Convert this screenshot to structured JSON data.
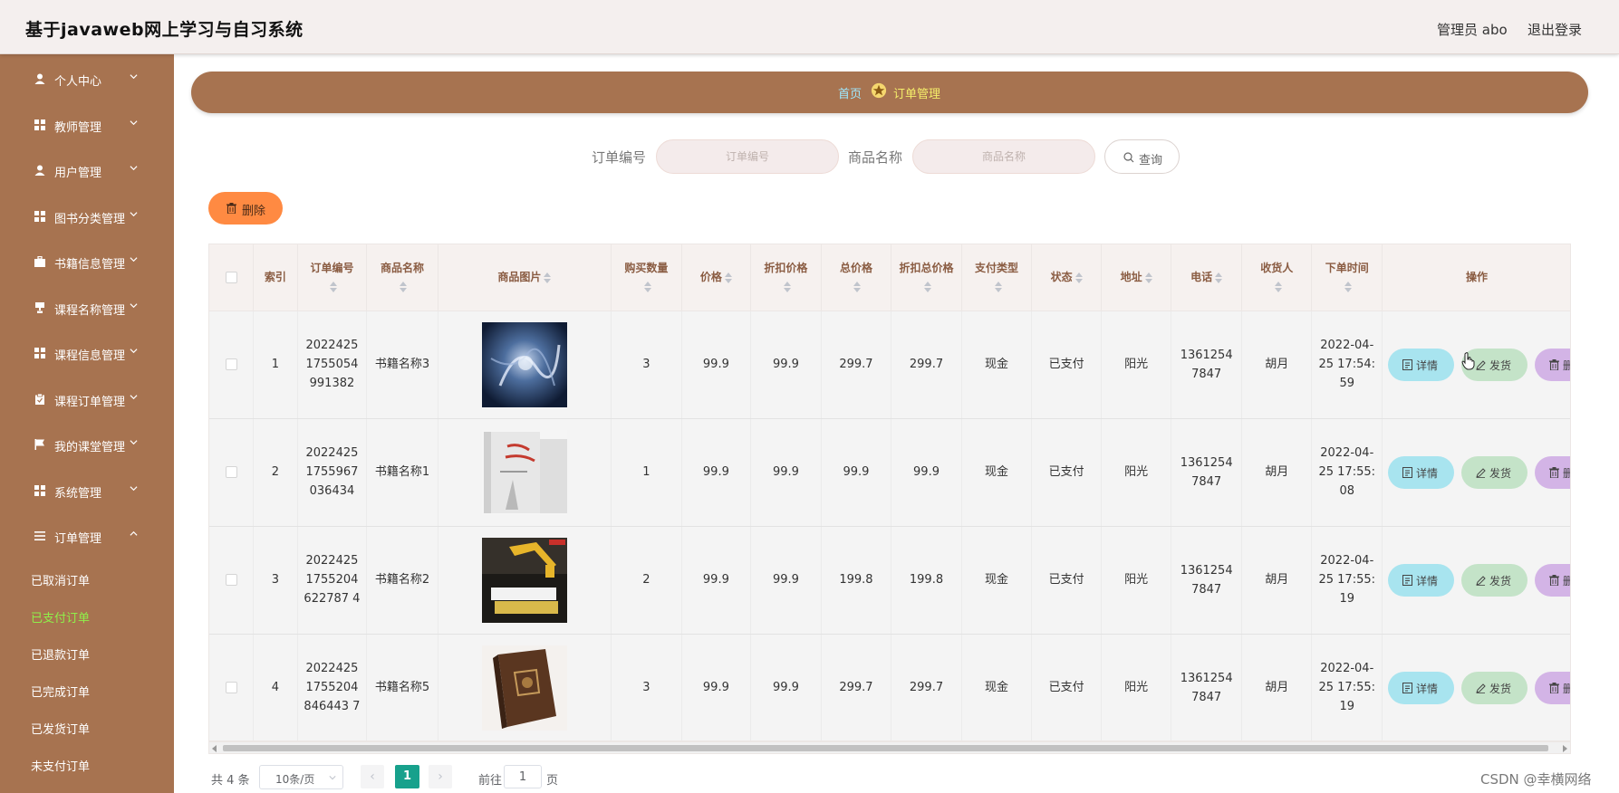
{
  "header": {
    "title": "基于javaweb网上学习与自习系统",
    "admin": "管理员 abo",
    "logout": "退出登录"
  },
  "sidebar": {
    "items": [
      {
        "label": "个人中心",
        "icon": "user-icon"
      },
      {
        "label": "教师管理",
        "icon": "grid-icon"
      },
      {
        "label": "用户管理",
        "icon": "user-icon"
      },
      {
        "label": "图书分类管理",
        "icon": "grid-icon"
      },
      {
        "label": "书籍信息管理",
        "icon": "briefcase-icon"
      },
      {
        "label": "课程名称管理",
        "icon": "trophy-icon"
      },
      {
        "label": "课程信息管理",
        "icon": "grid-icon"
      },
      {
        "label": "课程订单管理",
        "icon": "clipboard-icon"
      },
      {
        "label": "我的课堂管理",
        "icon": "flag-icon"
      },
      {
        "label": "系统管理",
        "icon": "grid-icon"
      },
      {
        "label": "订单管理",
        "icon": "list-icon"
      }
    ],
    "sub_items": [
      "已取消订单",
      "已支付订单",
      "已退款订单",
      "已完成订单",
      "已发货订单",
      "未支付订单"
    ],
    "active_sub": "已支付订单"
  },
  "breadcrumb": {
    "home": "首页",
    "current": "订单管理"
  },
  "search": {
    "order_no_label": "订单编号",
    "order_no_placeholder": "订单编号",
    "product_label": "商品名称",
    "product_placeholder": "商品名称",
    "button": "查询"
  },
  "toolbar": {
    "delete_label": "删除"
  },
  "table": {
    "headers": [
      "索引",
      "订单编号",
      "商品名称",
      "商品图片",
      "购买数量",
      "价格",
      "折扣价格",
      "总价格",
      "折扣总价格",
      "支付类型",
      "状态",
      "地址",
      "电话",
      "收货人",
      "下单时间",
      "操作"
    ],
    "rows": [
      {
        "index": "1",
        "order_no": "20224251755054991382",
        "product": "书籍名称3",
        "qty": "3",
        "price": "99.9",
        "discount_price": "99.9",
        "total": "299.7",
        "discount_total": "299.7",
        "pay_type": "现金",
        "status": "已支付",
        "address": "阳光",
        "phone": "13612547847",
        "receiver": "胡月",
        "time": "2022-04-25 17:54:59"
      },
      {
        "index": "2",
        "order_no": "20224251755967036434",
        "product": "书籍名称1",
        "qty": "1",
        "price": "99.9",
        "discount_price": "99.9",
        "total": "99.9",
        "discount_total": "99.9",
        "pay_type": "现金",
        "status": "已支付",
        "address": "阳光",
        "phone": "13612547847",
        "receiver": "胡月",
        "time": "2022-04-25 17:55:08"
      },
      {
        "index": "3",
        "order_no": "20224251755204622787 4",
        "product": "书籍名称2",
        "qty": "2",
        "price": "99.9",
        "discount_price": "99.9",
        "total": "199.8",
        "discount_total": "199.8",
        "pay_type": "现金",
        "status": "已支付",
        "address": "阳光",
        "phone": "13612547847",
        "receiver": "胡月",
        "time": "2022-04-25 17:55:19"
      },
      {
        "index": "4",
        "order_no": "20224251755204846443 7",
        "product": "书籍名称5",
        "qty": "3",
        "price": "99.9",
        "discount_price": "99.9",
        "total": "299.7",
        "discount_total": "299.7",
        "pay_type": "现金",
        "status": "已支付",
        "address": "阳光",
        "phone": "13612547847",
        "receiver": "胡月",
        "time": "2022-04-25 17:55:19"
      }
    ],
    "actions": {
      "detail": "详情",
      "ship": "发货",
      "delete": "删除"
    }
  },
  "pagination": {
    "total": "共 4 条",
    "page_size": "10条/页",
    "current": "1",
    "goto_label": "前往",
    "goto_value": "1",
    "page_label": "页"
  },
  "watermark": "CSDN @幸横网络",
  "colors": {
    "brand": "#a77350",
    "active_sub": "#8ff04a",
    "delete_main": "#ff8a42",
    "pager_active": "#17a18c"
  }
}
